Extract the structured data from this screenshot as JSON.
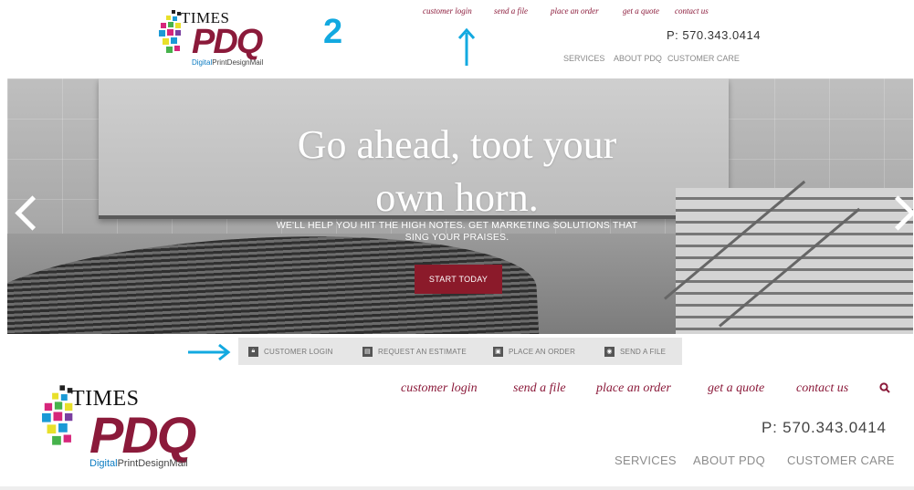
{
  "annotation": {
    "step_number": "2"
  },
  "logo": {
    "times": "TIMES",
    "pdq": "PDQ",
    "tagline_digital": "Digital",
    "tagline_rest": "PrintDesignMail"
  },
  "top_header": {
    "links": [
      "customer login",
      "send a file",
      "place an order",
      "get a quote",
      "contact us"
    ],
    "phone": "P: 570.343.0414",
    "nav": [
      "SERVICES",
      "ABOUT PDQ",
      "CUSTOMER CARE"
    ]
  },
  "hero": {
    "title_line1": "Go ahead, toot your",
    "title_line2": "own horn.",
    "subtitle_line1": "WE'LL HELP YOU HIT THE HIGH NOTES. GET MARKETING SOLUTIONS THAT",
    "subtitle_line2": "SING YOUR PRAISES.",
    "cta": "START TODAY"
  },
  "action_bar": {
    "items": [
      {
        "label": "CUSTOMER LOGIN",
        "icon": "lock-icon"
      },
      {
        "label": "REQUEST AN ESTIMATE",
        "icon": "document-icon"
      },
      {
        "label": "PLACE AN ORDER",
        "icon": "cart-icon"
      },
      {
        "label": "SEND A FILE",
        "icon": "camera-icon"
      }
    ]
  },
  "main_header": {
    "links": [
      "customer login",
      "send a file",
      "place an order",
      "get a quote",
      "contact us"
    ],
    "search_icon": "search-icon",
    "phone": "P: 570.343.0414",
    "nav": [
      "SERVICES",
      "ABOUT PDQ",
      "CUSTOMER CARE"
    ]
  },
  "colors": {
    "brand": "#8b1a3a",
    "annotation": "#12a9e0",
    "cta": "#8b1a2a",
    "action_bar": "#e6e6e6"
  }
}
